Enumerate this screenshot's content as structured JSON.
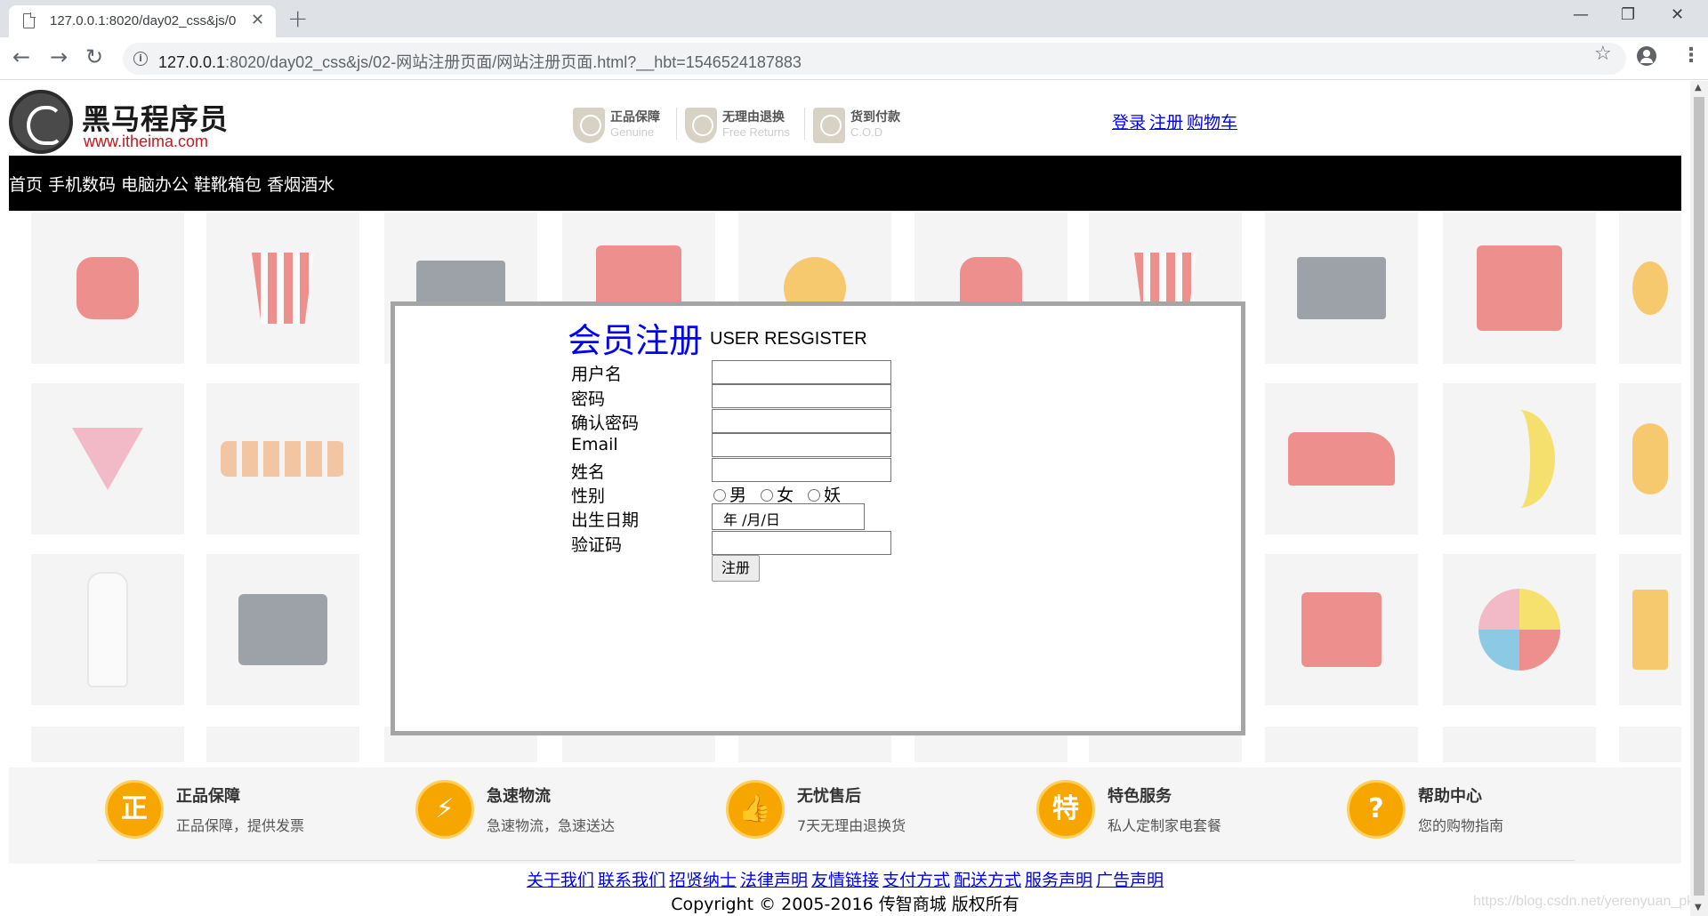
{
  "browser": {
    "tab_title": "127.0.0.1:8020/day02_css&js/0",
    "url_host": "127.0.0.1",
    "url_rest": ":8020/day02_css&js/02-网站注册页面/网站注册页面.html?__hbt=1546524187883"
  },
  "header": {
    "logo_cn": "黑马程序员",
    "logo_en": "www.itheima.com",
    "promos": [
      {
        "title": "正品保障",
        "sub": "Genuine"
      },
      {
        "title": "无理由退换",
        "sub": "Free Returns"
      },
      {
        "title": "货到付款",
        "sub": "C.O.D"
      }
    ],
    "links": [
      "登录",
      "注册",
      "购物车"
    ]
  },
  "nav": {
    "items": [
      "首页",
      "手机数码",
      "电脑办公",
      "鞋靴箱包",
      "香烟酒水"
    ]
  },
  "register": {
    "title": "会员注册",
    "subtitle": "USER RESGISTER",
    "fields": {
      "username": "用户名",
      "password": "密码",
      "confirm": "确认密码",
      "email": "Email",
      "name": "姓名",
      "gender": "性别",
      "birthday": "出生日期",
      "captcha": "验证码"
    },
    "gender_options": [
      "男",
      "女",
      "妖"
    ],
    "date_placeholder": "年 /月/日",
    "submit": "注册"
  },
  "services": [
    {
      "icon": "正",
      "title": "正品保障",
      "desc": "正品保障，提供发票"
    },
    {
      "icon": "⚡",
      "title": "急速物流",
      "desc": "急速物流，急速送达"
    },
    {
      "icon": "👍",
      "title": "无忧售后",
      "desc": "7天无理由退换货"
    },
    {
      "icon": "特",
      "title": "特色服务",
      "desc": "私人定制家电套餐"
    },
    {
      "icon": "?",
      "title": "帮助中心",
      "desc": "您的购物指南"
    }
  ],
  "footer": {
    "links": [
      "关于我们",
      "联系我们",
      "招贤纳士",
      "法律声明",
      "友情链接",
      "支付方式",
      "配送方式",
      "服务声明",
      "广告声明"
    ],
    "copyright": "Copyright © 2005-2016 传智商城 版权所有",
    "watermark": "https://blog.csdn.net/yerenyuan_pku"
  },
  "colors": {
    "accent_blue": "#0000ff",
    "nav_bg": "#000000",
    "service_orange": "#f7a600"
  }
}
